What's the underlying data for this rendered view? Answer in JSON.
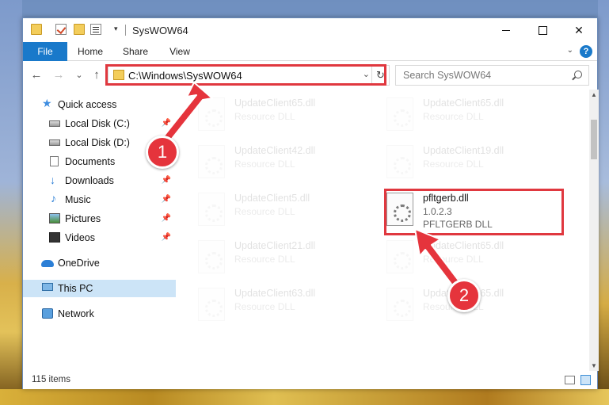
{
  "window": {
    "title": "SysWOW64",
    "qat_arrow": "▾",
    "close_glyph": "✕"
  },
  "ribbon": {
    "tabs": [
      "File",
      "Home",
      "Share",
      "View"
    ],
    "help_glyph": "?",
    "collapse_glyph": "⌄"
  },
  "address": {
    "path": "C:\\Windows\\SysWOW64",
    "back_glyph": "←",
    "forward_glyph": "→",
    "recent_glyph": "⌄",
    "up_glyph": "↑",
    "dropdown_glyph": "⌄",
    "refresh_glyph": "↻"
  },
  "search": {
    "placeholder": "Search SysWOW64"
  },
  "nav": {
    "pin_glyph": "📌",
    "items": [
      {
        "label": "Quick access",
        "icon": "star-icon",
        "glyph": "★"
      },
      {
        "label": "Local Disk (C:)",
        "icon": "drive-icon",
        "pinned": true
      },
      {
        "label": "Local Disk (D:)",
        "icon": "drive-icon"
      },
      {
        "label": "Documents",
        "icon": "document-icon",
        "pinned": true
      },
      {
        "label": "Downloads",
        "icon": "download-icon",
        "glyph": "↓",
        "pinned": true
      },
      {
        "label": "Music",
        "icon": "music-icon",
        "glyph": "♪",
        "pinned": true
      },
      {
        "label": "Pictures",
        "icon": "pictures-icon",
        "pinned": true
      },
      {
        "label": "Videos",
        "icon": "videos-icon",
        "pinned": true
      },
      {
        "label": "OneDrive",
        "icon": "onedrive-icon"
      },
      {
        "label": "This PC",
        "icon": "this-pc-icon",
        "selected": true
      },
      {
        "label": "Network",
        "icon": "network-icon"
      }
    ]
  },
  "files": [
    {
      "name": "UpdateClient65.dll",
      "type": "Resource DLL"
    },
    {
      "name": "UpdateClient65.dll",
      "type": "Resource DLL"
    },
    {
      "name": "UpdateClient42.dll",
      "type": "Resource DLL"
    },
    {
      "name": "UpdateClient19.dll",
      "type": "Resource DLL"
    },
    {
      "name": "UpdateClient5.dll",
      "type": "Resource DLL"
    },
    {
      "name": "pfltgerb.dll",
      "version": "1.0.2.3",
      "type": "PFLTGERB DLL",
      "focused": true
    },
    {
      "name": "UpdateClient21.dll",
      "type": "Resource DLL"
    },
    {
      "name": "UpdateClient65.dll",
      "type": "Resource DLL"
    },
    {
      "name": "UpdateClient63.dll",
      "type": "Resource DLL"
    },
    {
      "name": "UpdateClient65.dll",
      "type": "Resource DLL"
    }
  ],
  "scroll": {
    "up_glyph": "▲",
    "down_glyph": "▼"
  },
  "status": {
    "item_count": "115 items"
  },
  "annotations": {
    "step1": "1",
    "step2": "2",
    "highlight_color": "#e0383f"
  }
}
